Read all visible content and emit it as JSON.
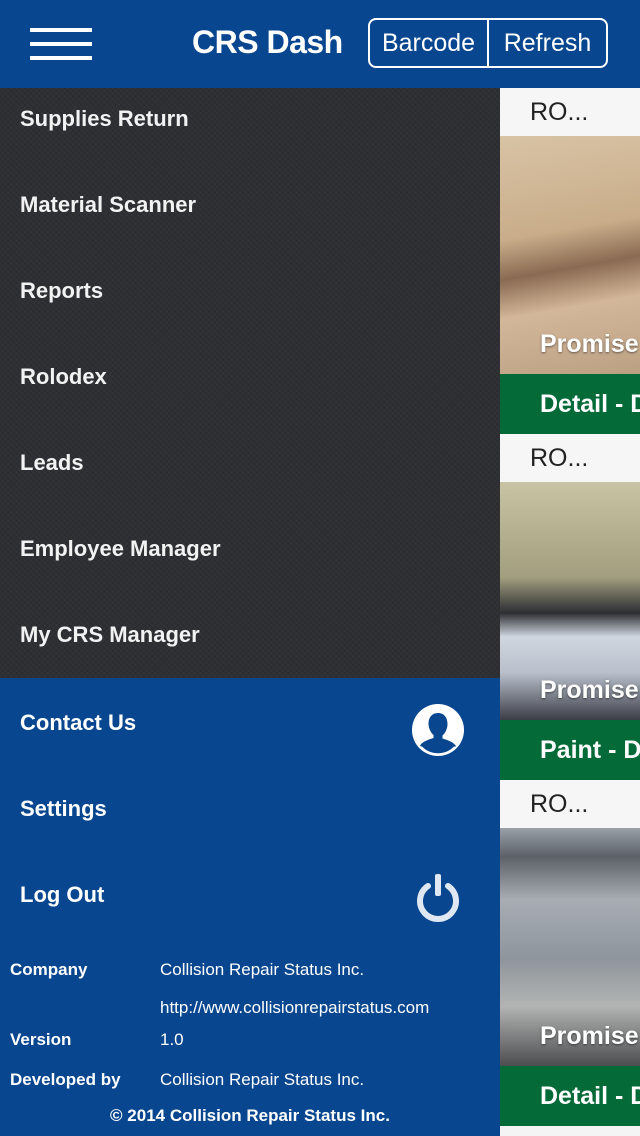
{
  "header": {
    "title": "CRS Dash",
    "menu_icon": "hamburger-menu-icon",
    "buttons": [
      {
        "label": "Barcode"
      },
      {
        "label": "Refresh"
      }
    ]
  },
  "sidebar": {
    "items": [
      {
        "label": "Supplies Return"
      },
      {
        "label": "Material Scanner"
      },
      {
        "label": "Reports"
      },
      {
        "label": "Rolodex"
      },
      {
        "label": "Leads"
      },
      {
        "label": "Employee Manager"
      },
      {
        "label": "My CRS Manager"
      }
    ],
    "secondary_items": [
      {
        "label": "Contact Us",
        "icon": "contact-person-icon"
      },
      {
        "label": "Settings"
      },
      {
        "label": "Log Out",
        "icon": "power-icon"
      }
    ],
    "info": {
      "company_label": "Company",
      "company_value": "Collision Repair Status Inc.",
      "website": "http://www.collisionrepairstatus.com",
      "version_label": "Version",
      "version_value": "1.0",
      "developer_label": "Developed by",
      "developer_value": "Collision Repair Status Inc.",
      "copyright": "© 2014 Collision Repair Status Inc."
    }
  },
  "cards": [
    {
      "ro": "RO...",
      "promise": "Promise",
      "status": "Detail - D"
    },
    {
      "ro": "RO...",
      "promise": "Promise",
      "status": "Paint - D"
    },
    {
      "ro": "RO...",
      "promise": "Promise",
      "status": "Detail - D"
    }
  ],
  "colors": {
    "header_blue": "#08468f",
    "menu_dark": "#2e2f33",
    "status_green": "#046a37"
  }
}
